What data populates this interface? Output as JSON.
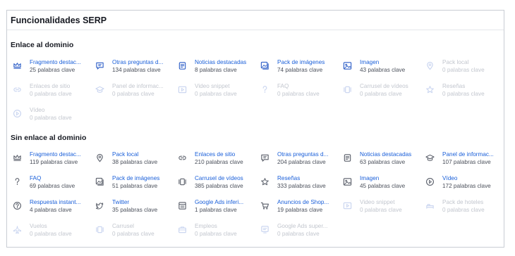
{
  "panel": {
    "title": "Funcionalidades SERP"
  },
  "sections": [
    {
      "title": "Enlace al dominio",
      "items": [
        {
          "label": "Fragmento destac...",
          "count": "25 palabras clave",
          "icon": "crown-icon",
          "state": "active"
        },
        {
          "label": "Otras preguntas d...",
          "count": "134 palabras clave",
          "icon": "chat-icon",
          "state": "active"
        },
        {
          "label": "Noticias destacadas",
          "count": "8 palabras clave",
          "icon": "news-icon",
          "state": "active"
        },
        {
          "label": "Pack de imágenes",
          "count": "74 palabras clave",
          "icon": "images-icon",
          "state": "active"
        },
        {
          "label": "Imagen",
          "count": "43 palabras clave",
          "icon": "image-icon",
          "state": "active"
        },
        {
          "label": "Pack local",
          "count": "0 palabras clave",
          "icon": "pin-icon",
          "state": "dim"
        },
        {
          "label": "Enlaces de sitio",
          "count": "0 palabras clave",
          "icon": "link-icon",
          "state": "dim"
        },
        {
          "label": "Panel de informac...",
          "count": "0 palabras clave",
          "icon": "cap-icon",
          "state": "dim"
        },
        {
          "label": "Video snippet",
          "count": "0 palabras clave",
          "icon": "video-box-icon",
          "state": "dim"
        },
        {
          "label": "FAQ",
          "count": "0 palabras clave",
          "icon": "question-icon",
          "state": "dim"
        },
        {
          "label": "Carrusel de vídeos",
          "count": "0 palabras clave",
          "icon": "carousel-icon",
          "state": "dim"
        },
        {
          "label": "Reseñas",
          "count": "0 palabras clave",
          "icon": "star-icon",
          "state": "dim"
        },
        {
          "label": "Vídeo",
          "count": "0 palabras clave",
          "icon": "play-icon",
          "state": "dim"
        }
      ]
    },
    {
      "title": "Sin enlace al dominio",
      "items": [
        {
          "label": "Fragmento destac...",
          "count": "119 palabras clave",
          "icon": "crown-icon",
          "state": "gray"
        },
        {
          "label": "Pack local",
          "count": "38 palabras clave",
          "icon": "pin-icon",
          "state": "gray"
        },
        {
          "label": "Enlaces de sitio",
          "count": "210 palabras clave",
          "icon": "link-icon",
          "state": "gray"
        },
        {
          "label": "Otras preguntas d...",
          "count": "204 palabras clave",
          "icon": "chat-icon",
          "state": "gray"
        },
        {
          "label": "Noticias destacadas",
          "count": "63 palabras clave",
          "icon": "news-icon",
          "state": "gray"
        },
        {
          "label": "Panel de informac...",
          "count": "107 palabras clave",
          "icon": "cap-icon",
          "state": "gray"
        },
        {
          "label": "FAQ",
          "count": "69 palabras clave",
          "icon": "question-icon",
          "state": "gray"
        },
        {
          "label": "Pack de imágenes",
          "count": "51 palabras clave",
          "icon": "images-icon",
          "state": "gray"
        },
        {
          "label": "Carrusel de vídeos",
          "count": "385 palabras clave",
          "icon": "carousel-icon",
          "state": "gray"
        },
        {
          "label": "Reseñas",
          "count": "333 palabras clave",
          "icon": "star-icon",
          "state": "gray"
        },
        {
          "label": "Imagen",
          "count": "45 palabras clave",
          "icon": "image-icon",
          "state": "gray"
        },
        {
          "label": "Vídeo",
          "count": "172 palabras clave",
          "icon": "play-icon",
          "state": "gray"
        },
        {
          "label": "Respuesta instant...",
          "count": "4 palabras clave",
          "icon": "answer-icon",
          "state": "gray"
        },
        {
          "label": "Twitter",
          "count": "35 palabras clave",
          "icon": "twitter-icon",
          "state": "gray"
        },
        {
          "label": "Google Ads inferi...",
          "count": "1 palabras clave",
          "icon": "ads-icon",
          "state": "gray"
        },
        {
          "label": "Anuncios de Shop...",
          "count": "19 palabras clave",
          "icon": "cart-icon",
          "state": "gray"
        },
        {
          "label": "Video snippet",
          "count": "0 palabras clave",
          "icon": "video-box-icon",
          "state": "dim"
        },
        {
          "label": "Pack de hoteles",
          "count": "0 palabras clave",
          "icon": "hotel-icon",
          "state": "dim"
        },
        {
          "label": "Vuelos",
          "count": "0 palabras clave",
          "icon": "plane-icon",
          "state": "dim"
        },
        {
          "label": "Carrusel",
          "count": "0 palabras clave",
          "icon": "carousel-icon",
          "state": "dim"
        },
        {
          "label": "Empleos",
          "count": "0 palabras clave",
          "icon": "briefcase-icon",
          "state": "dim"
        },
        {
          "label": "Google Ads super...",
          "count": "0 palabras clave",
          "icon": "ads-top-icon",
          "state": "dim"
        }
      ]
    }
  ]
}
